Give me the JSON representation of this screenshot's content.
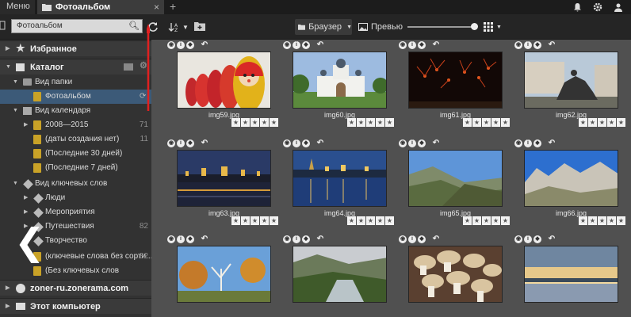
{
  "topbar": {
    "menu_label": "Меню",
    "tab_label": "Фотоальбом",
    "tab_close": "×",
    "new_tab": "+",
    "right_icons": [
      "bell-icon",
      "gear-icon",
      "profile-icon"
    ]
  },
  "toolbar": {
    "search_value": "Фотоальбом",
    "refresh_icon": "refresh-icon",
    "sort_label": "↓",
    "browser_label": "Браузер",
    "preview_label": "Превью",
    "zoom_level": 0.9
  },
  "sidebar": {
    "favorites_label": "Избранное",
    "catalog_label": "Каталог",
    "folder_view_label": "Вид папки",
    "folder_item_label": "Фотоальбом",
    "calendar_view_label": "Вид календаря",
    "calendar_items": [
      {
        "label": "2008—2015",
        "count": "71"
      },
      {
        "label": "(даты создания нет)",
        "count": "11"
      },
      {
        "label": "(Последние 30 дней)",
        "count": ""
      },
      {
        "label": "(Последние 7 дней)",
        "count": ""
      }
    ],
    "keyword_view_label": "Вид ключевых слов",
    "keyword_items": [
      {
        "label": "Люди",
        "count": ""
      },
      {
        "label": "Мероприятия",
        "count": ""
      },
      {
        "label": "Путешествия",
        "count": "82"
      },
      {
        "label": "Творчество",
        "count": ""
      },
      {
        "label": "(ключевые слова без сорти...",
        "count": "82"
      },
      {
        "label": "(Без ключевых слов",
        "count": ""
      }
    ],
    "zonerama_label": "zoner-ru.zonerama.com",
    "computer_label": "Этот компьютер"
  },
  "thumbs": [
    {
      "name": "img59.jpg"
    },
    {
      "name": "img60.jpg"
    },
    {
      "name": "img61.jpg"
    },
    {
      "name": "img62.jpg"
    },
    {
      "name": "img63.jpg"
    },
    {
      "name": "img64.jpg"
    },
    {
      "name": "img65.jpg"
    },
    {
      "name": "img66.jpg"
    },
    {
      "name": ""
    },
    {
      "name": ""
    },
    {
      "name": ""
    },
    {
      "name": ""
    }
  ],
  "colors": {
    "accent_red": "#e02020",
    "selection": "#3c5a78"
  }
}
